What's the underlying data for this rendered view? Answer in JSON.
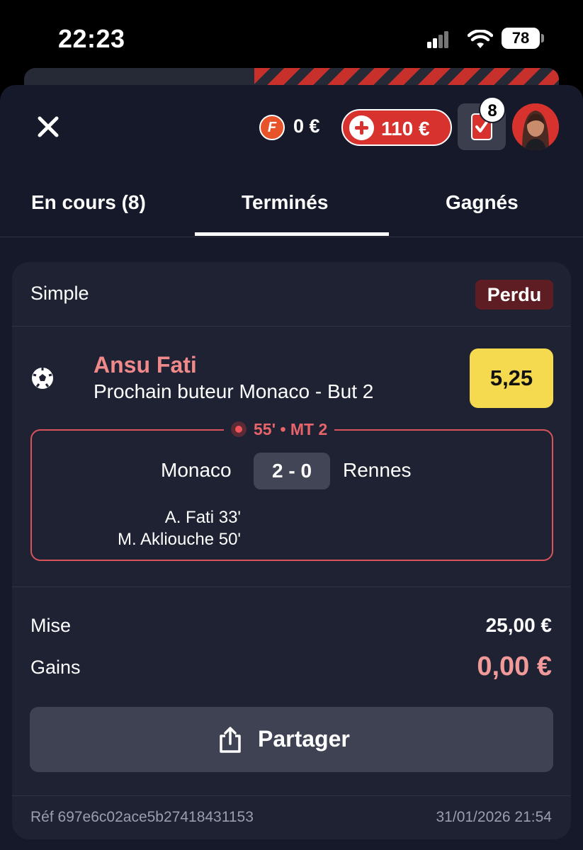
{
  "status_bar": {
    "time": "22:23",
    "battery": "78"
  },
  "header": {
    "freebet_letter": "F",
    "freebet_balance": "0 €",
    "balance": "110 €",
    "bets_count": "8",
    "colors": {
      "accent": "#d8322e",
      "background": "#15192a"
    }
  },
  "tabs": [
    {
      "label": "En cours (8)"
    },
    {
      "label": "Terminés",
      "active": true
    },
    {
      "label": "Gagnés"
    }
  ],
  "bet": {
    "type": "Simple",
    "status": "Perdu",
    "player": "Ansu Fati",
    "market": "Prochain buteur Monaco - But 2",
    "odds": "5,25",
    "live_time": "55' • MT 2",
    "home_team": "Monaco",
    "away_team": "Rennes",
    "score": "2 - 0",
    "scorers": [
      "A. Fati 33'",
      "M. Akliouche 50'"
    ],
    "stake_label": "Mise",
    "stake": "25,00 €",
    "winnings_label": "Gains",
    "winnings": "0,00 €",
    "share_label": "Partager",
    "reference": "Réf 697e6c02ace5b27418431153",
    "date": "31/01/2026 21:54"
  }
}
